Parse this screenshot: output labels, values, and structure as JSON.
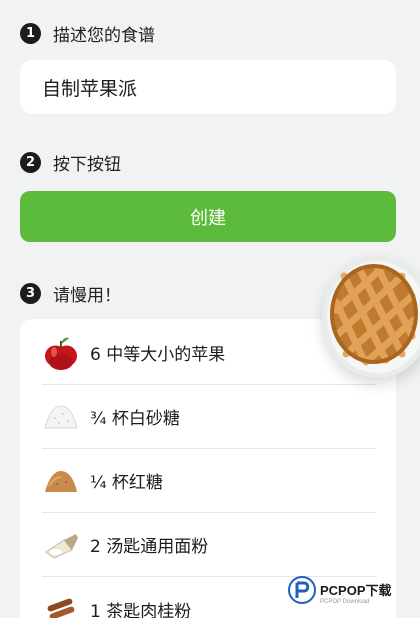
{
  "steps": [
    {
      "number": "1",
      "title": "描述您的食谱"
    },
    {
      "number": "2",
      "title": "按下按钮"
    },
    {
      "number": "3",
      "title": "请慢用！"
    }
  ],
  "recipe_input": {
    "value": "自制苹果派"
  },
  "create_button": {
    "label": "创建",
    "color": "#5cbb3b"
  },
  "ingredients": [
    {
      "icon": "apple-icon",
      "text": "6 中等大小的苹果"
    },
    {
      "icon": "white-sugar-icon",
      "text": "¾ 杯白砂糖"
    },
    {
      "icon": "brown-sugar-icon",
      "text": "¼ 杯红糖"
    },
    {
      "icon": "flour-icon",
      "text": "2 汤匙通用面粉"
    },
    {
      "icon": "cinnamon-icon",
      "text": "1 茶匙肉桂粉"
    }
  ],
  "watermark": {
    "main": "PCPOP下载",
    "sub": "PCPOP Download"
  }
}
